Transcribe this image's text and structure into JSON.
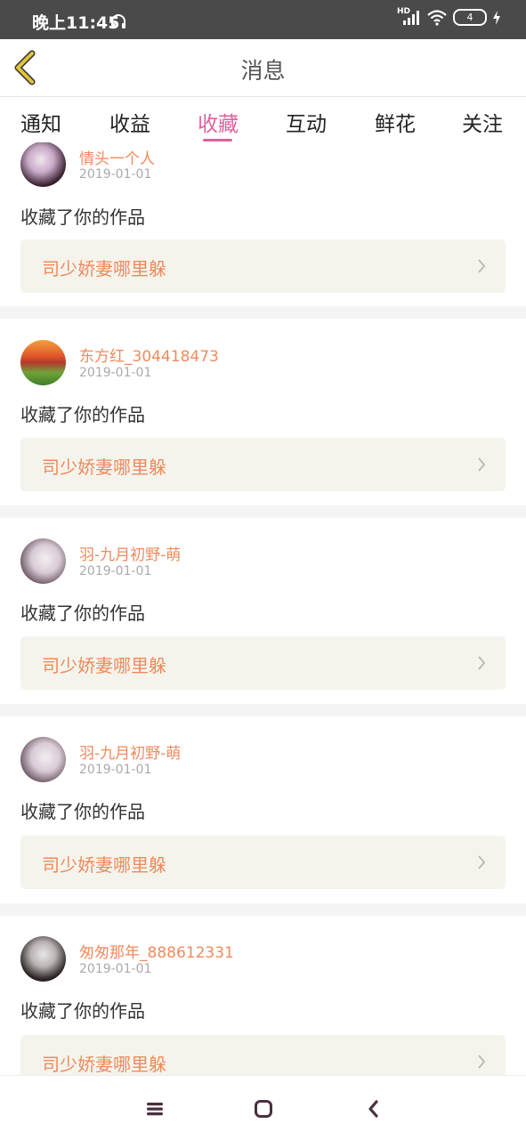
{
  "status": {
    "time": "晚上11:45",
    "hd": "HD",
    "battery": "4"
  },
  "header": {
    "title": "消息"
  },
  "tabs": [
    {
      "label": "通知"
    },
    {
      "label": "收益"
    },
    {
      "label": "收藏"
    },
    {
      "label": "互动"
    },
    {
      "label": "鲜花"
    },
    {
      "label": "关注"
    }
  ],
  "active_tab": "收藏",
  "items": [
    {
      "user": "情头一个人",
      "date": "2019-01-01",
      "action": "收藏了你的作品",
      "work": "司少娇妻哪里躲"
    },
    {
      "user": "东方红_304418473",
      "date": "2019-01-01",
      "action": "收藏了你的作品",
      "work": "司少娇妻哪里躲"
    },
    {
      "user": "羽-九月初野-萌",
      "date": "2019-01-01",
      "action": "收藏了你的作品",
      "work": "司少娇妻哪里躲"
    },
    {
      "user": "羽-九月初野-萌",
      "date": "2019-01-01",
      "action": "收藏了你的作品",
      "work": "司少娇妻哪里躲"
    },
    {
      "user": "匆匆那年_888612331",
      "date": "2019-01-01",
      "action": "收藏了你的作品",
      "work": "司少娇妻哪里躲"
    }
  ],
  "colors": {
    "accent": "#e0609d",
    "name": "#f08a5d",
    "card_bg": "#f5f4ec",
    "back_icon": "#e2c43a"
  }
}
